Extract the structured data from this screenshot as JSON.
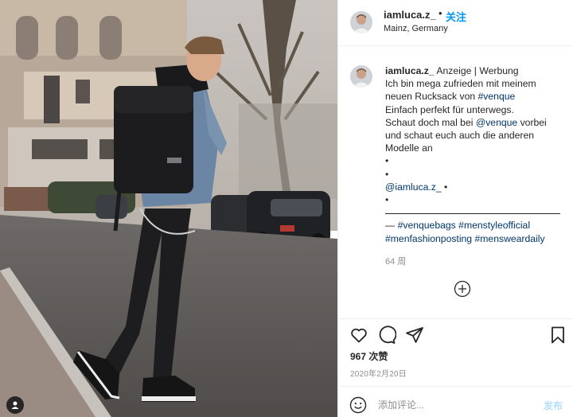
{
  "post": {
    "username": "iamluca.z_",
    "location": "Mainz, Germany",
    "header_dot": "•",
    "follow_label": "关注"
  },
  "caption": {
    "username": "iamluca.z_",
    "line1_text": " Anzeige | Werbung",
    "line2": "Ich bin mega zufrieden mit meinem",
    "line3_text": "neuen Rucksack von ",
    "line3_tag": "#venque",
    "line4": "Einfach perfekt für unterwegs.",
    "line5_text": "Schaut doch mal bei ",
    "line5_mention": "@venque",
    "line5_rest": " vorbei",
    "line6": "und schaut euch auch die anderen",
    "line7": "Modelle an",
    "bullet": "•",
    "mention_self": "@iamluca.z_",
    "mention_self_suffix": " •",
    "tag_prefix": "— ",
    "tags_line1": [
      "#venquebags",
      "#menstyleofficial"
    ],
    "tags_line2": [
      "#menfashionposting",
      "#mensweardaily"
    ],
    "time_ago": "64 周"
  },
  "actions": {
    "icons": [
      "heart-icon",
      "comment-icon",
      "share-icon",
      "bookmark-icon"
    ],
    "likes": "967 次赞",
    "date": "2020年2月20日"
  },
  "comment": {
    "placeholder": "添加评论...",
    "post_label": "发布"
  },
  "colors": {
    "link": "#00376b",
    "follow": "#0095f6",
    "post_disabled": "#b2dffc",
    "muted": "#8e8e8e",
    "text": "#262626"
  }
}
